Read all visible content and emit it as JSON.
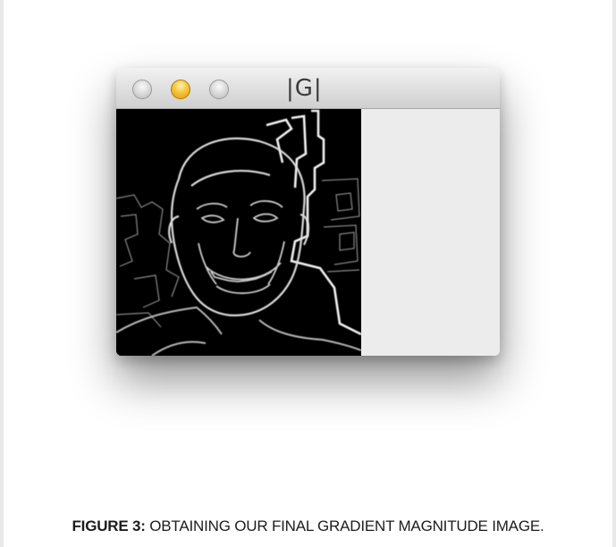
{
  "window": {
    "title": "|G|",
    "buttons": [
      {
        "name": "close",
        "color": "gray"
      },
      {
        "name": "minimize",
        "color": "yellow"
      },
      {
        "name": "zoom",
        "color": "gray"
      }
    ]
  },
  "image": {
    "subject": "gradient-magnitude-edge-image"
  },
  "caption": {
    "label": "FIGURE 3:",
    "text": " OBTAINING OUR FINAL GRADIENT MAGNITUDE IMAGE."
  },
  "colors": {
    "page_background": "#ffffff",
    "image_background": "#000000",
    "window_content_background": "#ececec",
    "yellow_button": "#f6c53c"
  }
}
